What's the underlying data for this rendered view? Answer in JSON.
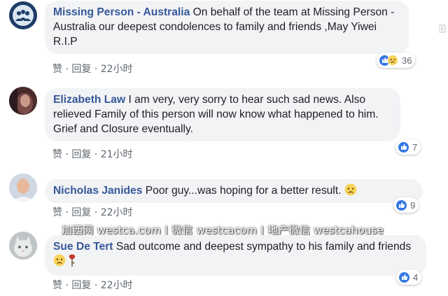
{
  "comments": [
    {
      "author": "Missing Person - Australia",
      "text": "On behalf of the team at Missing Person -Australia our deepest condolences to family and friends ,May Yiwei R.I.P",
      "like_label": "赞",
      "separator": "·",
      "reply_label": "回复",
      "time": "22小时",
      "reaction_count": "36",
      "reaction_icons": [
        "like-icon",
        "sad-icon"
      ]
    },
    {
      "author": "Elizabeth Law",
      "text": "I am very, very sorry to hear such sad news. Also relieved Family of this person will now know what happened to him. Grief and Closure eventually.",
      "like_label": "赞",
      "separator": "·",
      "reply_label": "回复",
      "time": "21小时",
      "reaction_count": "7",
      "reaction_icons": [
        "like-icon"
      ]
    },
    {
      "author": "Nicholas Janides",
      "text": "Poor guy...was hoping for a better result.",
      "like_label": "赞",
      "separator": "·",
      "reply_label": "回复",
      "time": "22小时",
      "reaction_count": "9",
      "reaction_icons": [
        "like-icon"
      ]
    },
    {
      "author": "Sue De Tert",
      "text": "Sad outcome and deepest sympathy to his family and friends",
      "like_label": "赞",
      "separator": "·",
      "reply_label": "回复",
      "time": "22小时",
      "reaction_count": "4",
      "reaction_icons": [
        "like-icon"
      ]
    }
  ],
  "watermark": "加西网 westca.com | 微信 westcacom | 地产微信 westcahouse",
  "colors": {
    "author": "#365899",
    "bubble": "#f2f3f5",
    "like_blue": "#3578e5",
    "meta_gray": "#606770"
  }
}
